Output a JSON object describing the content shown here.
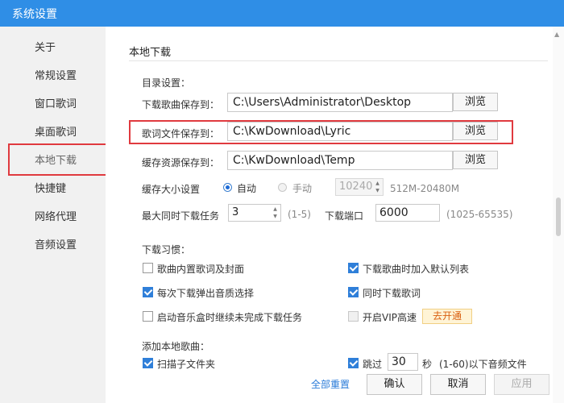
{
  "window": {
    "title": "系统设置"
  },
  "sidebar": {
    "items": [
      {
        "label": "关于"
      },
      {
        "label": "常规设置"
      },
      {
        "label": "窗口歌词"
      },
      {
        "label": "桌面歌词"
      },
      {
        "label": "本地下载"
      },
      {
        "label": "快捷键"
      },
      {
        "label": "网络代理"
      },
      {
        "label": "音频设置"
      }
    ],
    "active_index": 4
  },
  "section": {
    "title": "本地下载",
    "dir_settings_label": "目录设置：",
    "paths": [
      {
        "label": "下载歌曲保存到：",
        "value": "C:\\Users\\Administrator\\Desktop",
        "browse": "浏览"
      },
      {
        "label": "歌词文件保存到：",
        "value": "C:\\KwDownload\\Lyric",
        "browse": "浏览"
      },
      {
        "label": "缓存资源保存到：",
        "value": "C:\\KwDownload\\Temp",
        "browse": "浏览"
      }
    ],
    "cache": {
      "label": "缓存大小设置",
      "auto_label": "自动",
      "manual_label": "手动",
      "selected": "自动",
      "size_value": "10240",
      "size_range": "512M-20480M"
    },
    "max_tasks": {
      "label": "最大同时下载任务",
      "value": "3",
      "range": "(1-5)"
    },
    "port": {
      "label": "下载端口",
      "value": "6000",
      "range": "(1025-65535)"
    },
    "habits": {
      "label": "下载习惯：",
      "items": [
        {
          "label": "歌曲内置歌词及封面",
          "checked": false
        },
        {
          "label": "下载歌曲时加入默认列表",
          "checked": true
        },
        {
          "label": "每次下载弹出音质选择",
          "checked": true
        },
        {
          "label": "同时下载歌词",
          "checked": true
        },
        {
          "label": "启动音乐盒时继续未完成下载任务",
          "checked": false
        },
        {
          "label": "开启VIP高速",
          "checked": false,
          "disabled": true
        }
      ],
      "vip_button": "去开通"
    },
    "add_local": {
      "label": "添加本地歌曲：",
      "scan_subfolders": {
        "label": "扫描子文件夹",
        "checked": true
      },
      "skip": {
        "label": "跳过",
        "checked": true,
        "seconds": "30",
        "unit": "秒",
        "suffix": "(1-60)以下音频文件"
      }
    }
  },
  "footer": {
    "reset_label": "全部重置",
    "ok_label": "确认",
    "cancel_label": "取消",
    "apply_label": "应用"
  },
  "colors": {
    "titlebar": "#2f8ee6",
    "highlight": "#e03a3f",
    "checkbox": "#2f7fd9",
    "link": "#2a7bd8"
  }
}
